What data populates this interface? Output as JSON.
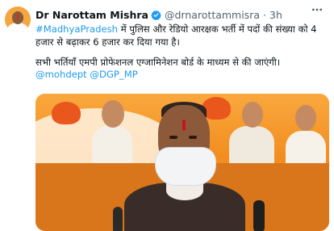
{
  "tweet": {
    "author_name": "Dr Narottam Mishra",
    "handle": "@drnarottammisra",
    "separator": "·",
    "time": "3h",
    "hashtag": "#MadhyaPradesh",
    "line1_rest": " में पुलिस और रेडियो आरक्षक भर्ती में पदों की संख्या को 4 हजार से बढ़ाकर 6 हजार कर दिया गया है।",
    "line2": "सभी भर्तियाँ एमपी प्रोफेशनल एग्जामिनेशन बोर्ड के माध्यम से की जाएंगी।",
    "mention1": "@mohdept",
    "mention2": "@DGP_MP"
  },
  "icons": {
    "verified": "verified-badge-icon",
    "more": "more-options-icon"
  },
  "colors": {
    "link": "#1d9bf0",
    "text": "#0f1419",
    "muted": "#536471",
    "media_background": "#f28d1f"
  }
}
